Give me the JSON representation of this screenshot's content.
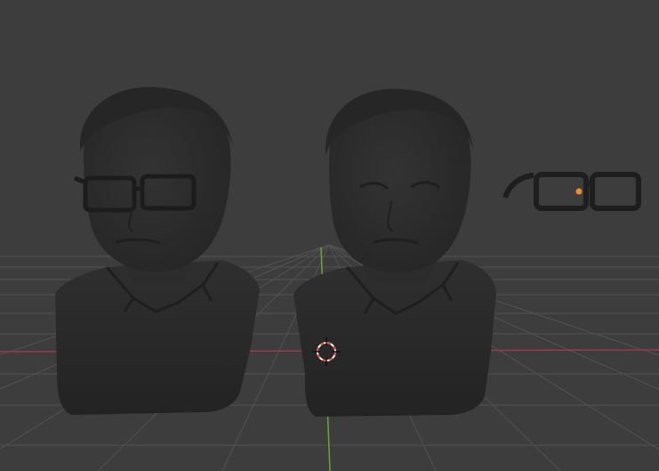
{
  "app": "Blender",
  "view": "3d-viewport",
  "colors": {
    "background": "#3d3d3d",
    "grid": "#555555",
    "x_axis": "#9a3b46",
    "y_axis": "#6ea33a",
    "cursor_red": "#e84a4a",
    "cursor_white": "#ffffff",
    "object_origin": "#f08a2a",
    "mesh_dark": "#262626",
    "mesh_mid": "#2e2e2e"
  },
  "objects": [
    {
      "name": "bust-with-glasses-icon"
    },
    {
      "name": "bust-icon"
    },
    {
      "name": "glasses-icon"
    }
  ]
}
